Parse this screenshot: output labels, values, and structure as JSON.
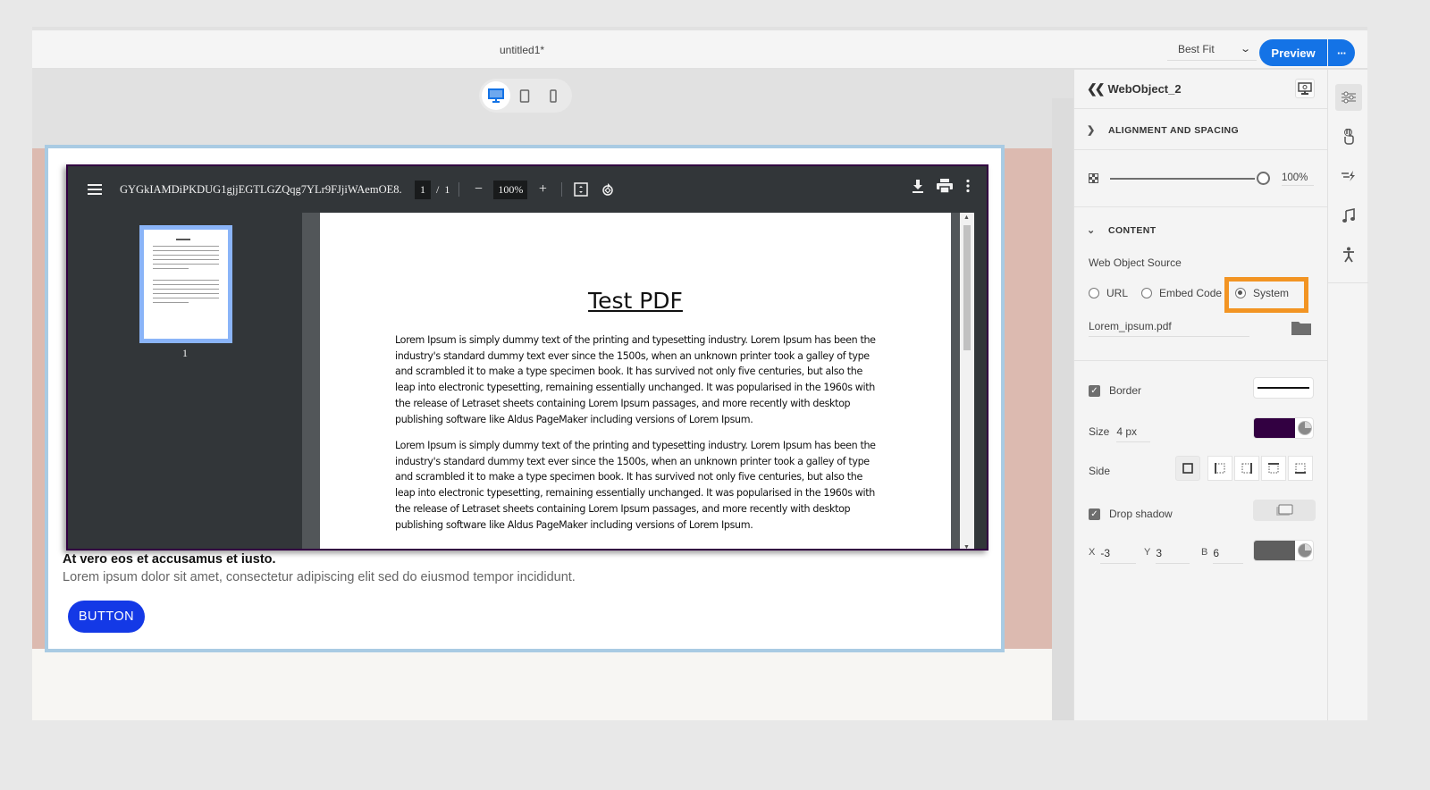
{
  "header": {
    "doc_title": "untitled1*",
    "fit_select": "Best Fit",
    "preview_label": "Preview",
    "more_label": "···"
  },
  "device_switcher": {
    "options": [
      {
        "name": "desktop",
        "icon": "desktop-icon",
        "active": true
      },
      {
        "name": "tablet",
        "icon": "tablet-icon",
        "active": false
      },
      {
        "name": "mobile",
        "icon": "mobile-icon",
        "active": false
      }
    ]
  },
  "pdf_viewer": {
    "file_name": "GYGkIAMDiPKDUG1gjjEGTLGZQqg7YLr9FJjiWAemOE8...",
    "current_page": "1",
    "page_sep": "/",
    "total_pages": "1",
    "zoom": "100%",
    "thumbnail_label": "1",
    "document": {
      "title": "Test PDF",
      "paragraphs": [
        "Lorem Ipsum is simply dummy text of the printing and typesetting industry. Lorem Ipsum has been the industry's standard dummy text ever since the 1500s, when an unknown printer took a galley of type and scrambled it to make a type specimen book. It has survived not only five centuries, but also the leap into electronic typesetting, remaining essentially unchanged. It was popularised in the 1960s with the release of Letraset sheets containing Lorem Ipsum passages, and more recently with desktop publishing software like Aldus PageMaker including versions of Lorem Ipsum.",
        "Lorem Ipsum is simply dummy text of the printing and typesetting industry. Lorem Ipsum has been the industry's standard dummy text ever since the 1500s, when an unknown printer took a galley of type and scrambled it to make a type specimen book. It has survived not only five centuries, but also the leap into electronic typesetting, remaining essentially unchanged. It was popularised in the 1960s with the release of Letraset sheets containing Lorem Ipsum passages, and more recently with desktop publishing software like Aldus PageMaker including versions of Lorem Ipsum."
      ]
    }
  },
  "slide": {
    "heading": "At vero eos et accusamus et iusto.",
    "body": "Lorem ipsum dolor sit amet, consectetur adipiscing elit sed do eiusmod tempor incididunt.",
    "button_label": "BUTTON"
  },
  "panel": {
    "object_name": "WebObject_2",
    "alignment_section": "ALIGNMENT AND SPACING",
    "opacity_value": "100%",
    "opacity_fraction": 1.0,
    "content_section": "CONTENT",
    "source_label": "Web Object Source",
    "source_options": [
      {
        "label": "URL",
        "selected": false
      },
      {
        "label": "Embed Code",
        "selected": false
      },
      {
        "label": "System",
        "selected": true
      }
    ],
    "file_name": "Lorem_ipsum.pdf",
    "border": {
      "label": "Border",
      "checked": true,
      "size_label": "Size",
      "size_value": "4 px",
      "color": "#320041",
      "side_label": "Side"
    },
    "shadow": {
      "label": "Drop shadow",
      "checked": true,
      "x_label": "X",
      "x_value": "-3",
      "y_label": "Y",
      "y_value": "3",
      "b_label": "B",
      "b_value": "6",
      "color": "#5e5e5e"
    }
  },
  "rail": {
    "items": [
      "properties-icon",
      "interaction-icon",
      "effects-icon",
      "audio-icon",
      "accessibility-icon"
    ]
  },
  "colors": {
    "accent": "#1473e6",
    "highlight": "#f29423",
    "slide_button": "#1439e6"
  }
}
